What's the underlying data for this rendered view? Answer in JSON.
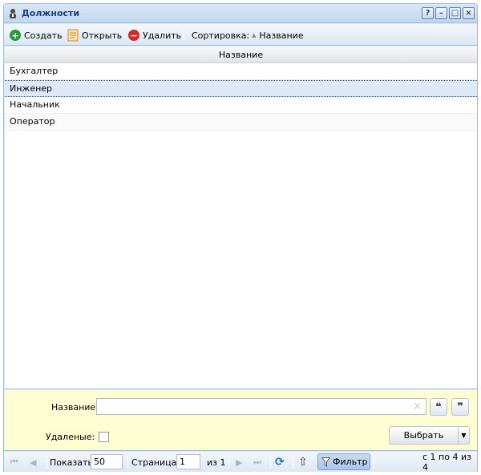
{
  "window": {
    "title": "Должности",
    "tools": {
      "help": "?",
      "minimize": "–",
      "maximize": "□",
      "close": "×"
    }
  },
  "toolbar": {
    "create_label": "Создать",
    "open_label": "Открыть",
    "delete_label": "Удалить",
    "sort_label": "Сортировка:",
    "sort_field": "Название",
    "sort_icon": "▲"
  },
  "grid": {
    "column_header": "Название",
    "rows": [
      "Бухгалтер",
      "Инженер",
      "Начальник",
      "Оператор"
    ],
    "selected_row": "Инженер"
  },
  "filter_panel": {
    "name_label": "Название:",
    "name_value": "",
    "clear_glyph": "×",
    "quote_open": "❝",
    "quote_close": "❞",
    "deleted_label": "Удаленые:",
    "deleted_checked": false,
    "select_label": "Выбрать",
    "select_arrow": "▼"
  },
  "pager": {
    "first": "⏮",
    "prev": "◀",
    "next": "▶",
    "last": "⏭",
    "show_label": "Показать",
    "page_size": "50",
    "page_label": "Страница",
    "page_value": "1",
    "of_label": "из 1",
    "refresh_icon": "⟳",
    "export_icon": "⇧",
    "filter_label": "Фильтр",
    "summary": "с 1 по 4 из 4"
  },
  "colors": {
    "accent": "#15428b",
    "border": "#99bbe8",
    "create": "#2a9a3a",
    "delete": "#d62a2a",
    "filter_bg": "#fefed2"
  }
}
